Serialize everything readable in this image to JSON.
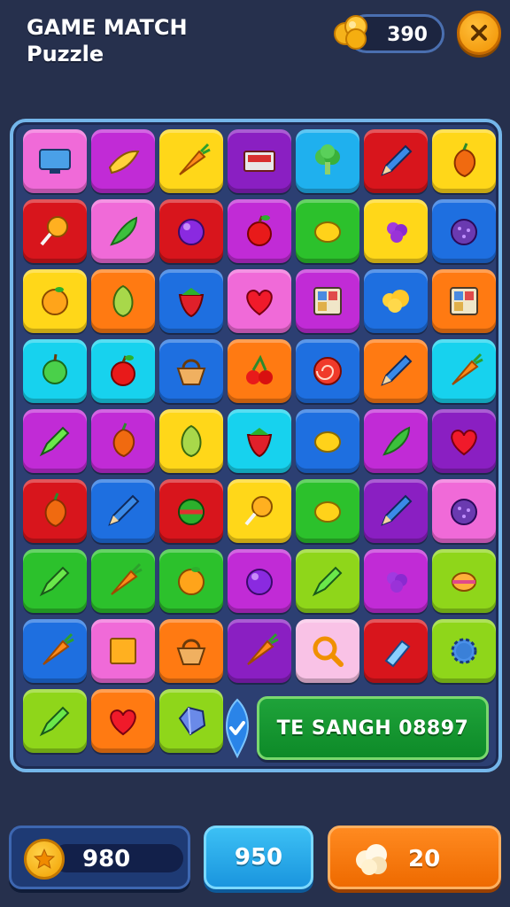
{
  "header": {
    "title_line1": "GAME MATCH",
    "title_line2": "Puzzle",
    "coins": "390",
    "close_icon": "close-icon"
  },
  "colors": {
    "background": "#26304d",
    "board_border": "#74b6ea",
    "pink": "#f06ad8",
    "magenta": "#c12bd6",
    "yellow": "#ffd719",
    "purple": "#8a1fc2",
    "sky": "#1fb0ee",
    "red": "#d8151c",
    "green": "#2cc12c",
    "blue": "#1e6fe0",
    "orange": "#ff7a12",
    "cyan": "#17d2ee",
    "lime": "#8fd61a",
    "lightpink": "#f9c2e6",
    "teal": "#19c7d4"
  },
  "board": {
    "rows": [
      [
        {
          "c": "pink",
          "i": "monitor-icon"
        },
        {
          "c": "magenta",
          "i": "banana-icon"
        },
        {
          "c": "yellow",
          "i": "carrot-icon"
        },
        {
          "c": "purple",
          "i": "cassette-icon"
        },
        {
          "c": "sky",
          "i": "broccoli-icon"
        },
        {
          "c": "red",
          "i": "pencil-icon"
        },
        {
          "c": "yellow",
          "i": "pepper-icon"
        }
      ],
      [
        {
          "c": "red",
          "i": "lollipop-icon"
        },
        {
          "c": "pink",
          "i": "chili-icon"
        },
        {
          "c": "red",
          "i": "plum-icon"
        },
        {
          "c": "magenta",
          "i": "apple-icon"
        },
        {
          "c": "green",
          "i": "lemon-icon"
        },
        {
          "c": "yellow",
          "i": "grape-icon"
        },
        {
          "c": "blue",
          "i": "berry-icon"
        }
      ],
      [
        {
          "c": "yellow",
          "i": "orange-icon"
        },
        {
          "c": "orange",
          "i": "avocado-icon"
        },
        {
          "c": "blue",
          "i": "strawberry-icon"
        },
        {
          "c": "pink",
          "i": "heart-icon"
        },
        {
          "c": "magenta",
          "i": "window-icon"
        },
        {
          "c": "blue",
          "i": "cloud-icon"
        },
        {
          "c": "orange",
          "i": "window-icon"
        }
      ],
      [
        {
          "c": "cyan",
          "i": "lime-icon"
        },
        {
          "c": "cyan",
          "i": "apple-icon"
        },
        {
          "c": "blue",
          "i": "basket-icon"
        },
        {
          "c": "orange",
          "i": "cherry-icon"
        },
        {
          "c": "blue",
          "i": "swirl-icon"
        },
        {
          "c": "orange",
          "i": "pencil-icon"
        },
        {
          "c": "cyan",
          "i": "carrot-icon"
        }
      ],
      [
        {
          "c": "magenta",
          "i": "marker-icon"
        },
        {
          "c": "magenta",
          "i": "pepper-icon"
        },
        {
          "c": "yellow",
          "i": "avocado-icon"
        },
        {
          "c": "cyan",
          "i": "strawberry-icon"
        },
        {
          "c": "blue",
          "i": "lemon-icon"
        },
        {
          "c": "magenta",
          "i": "chili-icon"
        },
        {
          "c": "purple",
          "i": "heart-icon"
        }
      ],
      [
        {
          "c": "red",
          "i": "pepper-icon"
        },
        {
          "c": "blue",
          "i": "pencil-icon"
        },
        {
          "c": "red",
          "i": "melon-icon"
        },
        {
          "c": "yellow",
          "i": "lollipop-icon"
        },
        {
          "c": "green",
          "i": "lemon-icon"
        },
        {
          "c": "purple",
          "i": "pencil-icon"
        },
        {
          "c": "pink",
          "i": "berry-icon"
        }
      ],
      [
        {
          "c": "green",
          "i": "marker-icon"
        },
        {
          "c": "green",
          "i": "carrot-icon"
        },
        {
          "c": "green",
          "i": "orange-icon"
        },
        {
          "c": "magenta",
          "i": "plum-icon"
        },
        {
          "c": "lime",
          "i": "marker-icon"
        },
        {
          "c": "magenta",
          "i": "grape-icon"
        },
        {
          "c": "lime",
          "i": "candy-icon"
        }
      ],
      [
        {
          "c": "blue",
          "i": "carrot-icon"
        },
        {
          "c": "pink",
          "i": "square-icon"
        },
        {
          "c": "orange",
          "i": "basket-icon"
        },
        {
          "c": "purple",
          "i": "carrot-icon"
        },
        {
          "c": "lightpink",
          "i": "magnifier-icon"
        },
        {
          "c": "red",
          "i": "bottle-icon"
        },
        {
          "c": "lime",
          "i": "gear-icon"
        }
      ],
      [
        {
          "c": "lime",
          "i": "marker-icon"
        },
        {
          "c": "orange",
          "i": "heart-icon"
        },
        {
          "c": "lime",
          "i": "gem-icon"
        }
      ]
    ]
  },
  "banner": {
    "text": "TE SANGH 08897",
    "check_icon": "check-icon"
  },
  "footer": {
    "coins": "980",
    "score": "950",
    "popcorn": "20"
  }
}
